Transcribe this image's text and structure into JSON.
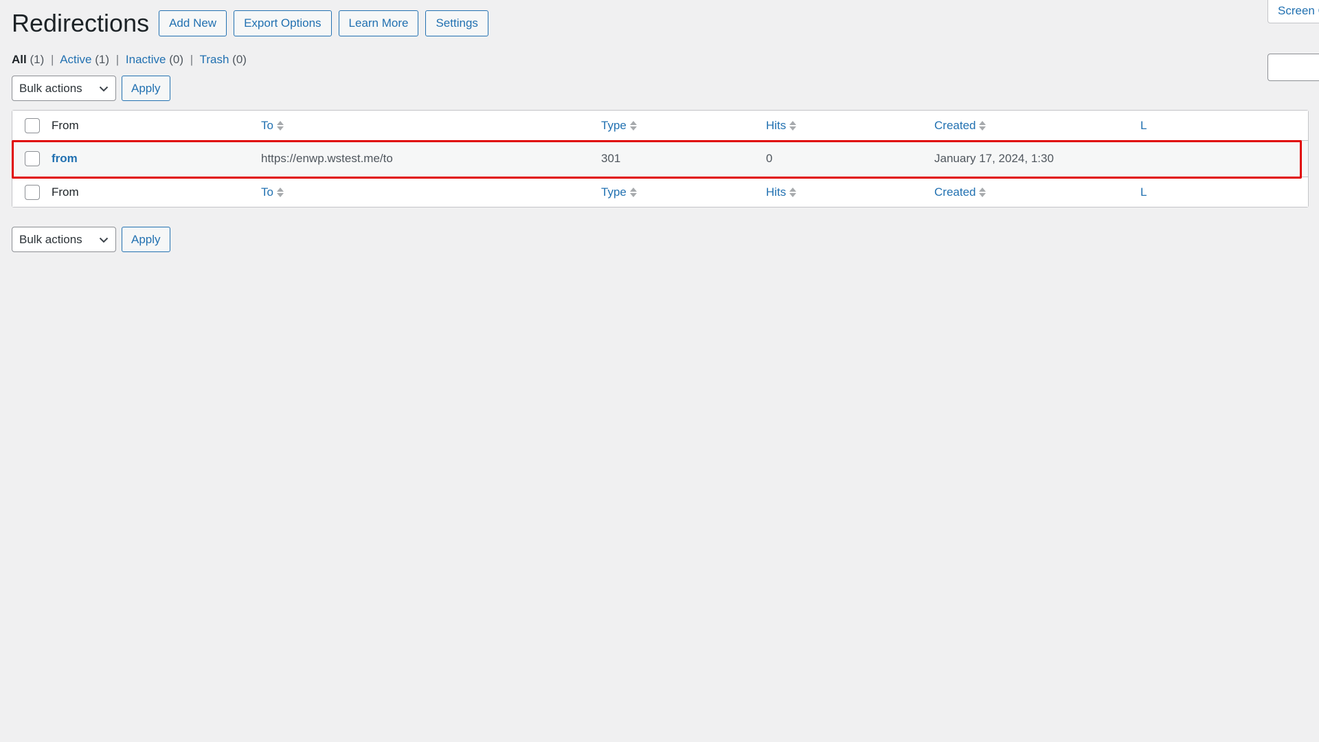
{
  "header": {
    "title": "Redirections",
    "buttons": [
      {
        "label": "Add New",
        "name": "add-new-button"
      },
      {
        "label": "Export Options",
        "name": "export-options-button"
      },
      {
        "label": "Learn More",
        "name": "learn-more-button"
      },
      {
        "label": "Settings",
        "name": "settings-button"
      }
    ]
  },
  "screen_options": {
    "label": "Screen Options"
  },
  "search": {
    "value": "",
    "placeholder": ""
  },
  "filters": {
    "links": [
      {
        "label": "All",
        "count": "(1)",
        "current": true
      },
      {
        "label": "Active",
        "count": "(1)",
        "current": false
      },
      {
        "label": "Inactive",
        "count": "(0)",
        "current": false
      },
      {
        "label": "Trash",
        "count": "(0)",
        "current": false
      }
    ],
    "separator": "|"
  },
  "tablenav": {
    "bulk_label": "Bulk actions",
    "apply_label": "Apply",
    "chevron_icon": "chevron-down-icon"
  },
  "table": {
    "columns": {
      "from": "From",
      "to": "To",
      "type": "Type",
      "hits": "Hits",
      "created": "Created",
      "last_access": "L"
    },
    "rows": [
      {
        "from": "from",
        "to": "https://enwp.wstest.me/to",
        "type": "301",
        "hits": "0",
        "created": "January 17, 2024, 1:30",
        "last_access": ""
      }
    ]
  },
  "colors": {
    "accent": "#2271b1",
    "highlight": "#e00000",
    "page_bg": "#f0f0f1",
    "row_bg": "#f6f7f7"
  }
}
